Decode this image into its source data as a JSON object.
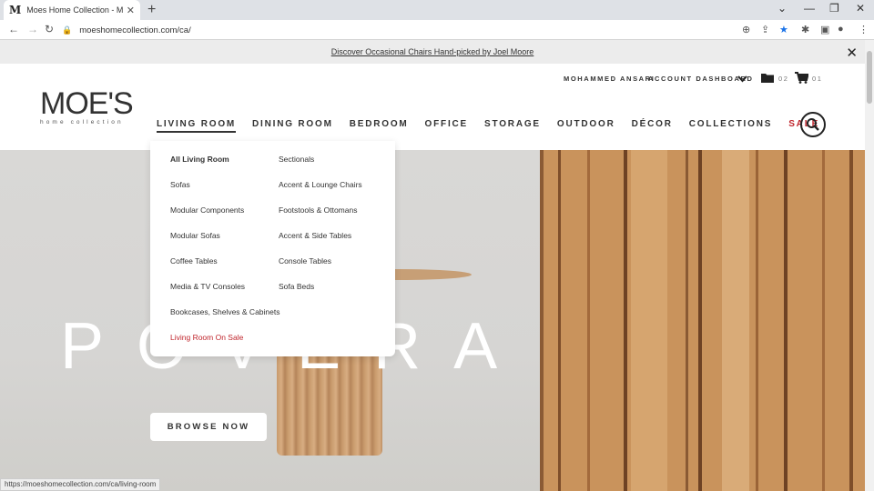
{
  "browser": {
    "tab_title": "Moes Home Collection - Moe's H",
    "tab_favicon": "M",
    "url": "moeshomecollection.com/ca/",
    "status_url": "https://moeshomecollection.com/ca/living-room"
  },
  "announcement": {
    "text": "Discover Occasional Chairs Hand-picked by Joel Moore"
  },
  "header": {
    "logo_main": "MOE'S",
    "logo_sub": "home collection",
    "user_name": "MOHAMMED ANSARI",
    "account_label": "ACCOUNT DASHBOARD",
    "folder_count": "02",
    "cart_count": "01"
  },
  "nav": {
    "items": [
      "LIVING ROOM",
      "DINING ROOM",
      "BEDROOM",
      "OFFICE",
      "STORAGE",
      "OUTDOOR",
      "DÉCOR",
      "COLLECTIONS",
      "SALE"
    ]
  },
  "dropdown": {
    "col1": [
      "All Living Room",
      "Sofas",
      "Modular Components",
      "Modular Sofas",
      "Coffee Tables",
      "Media & TV Consoles",
      "Bookcases, Shelves & Cabinets",
      "Living Room On Sale"
    ],
    "col2": [
      "Sectionals",
      "Accent & Lounge Chairs",
      "Footstools & Ottomans",
      "Accent & Side Tables",
      "Console Tables",
      "Sofa Beds"
    ]
  },
  "hero": {
    "title": "POVERA",
    "cta": "BROWSE NOW"
  },
  "colors": {
    "sale": "#c0262d",
    "text": "#333333",
    "announce_bg": "#ececec"
  }
}
